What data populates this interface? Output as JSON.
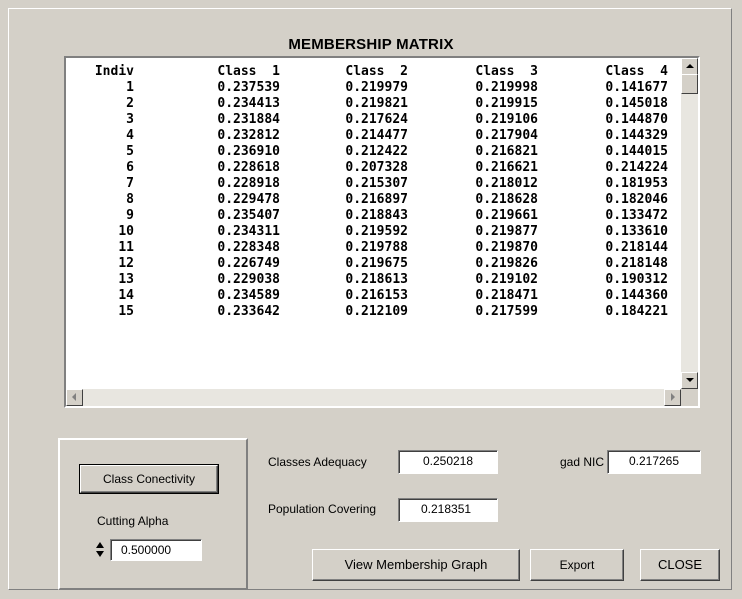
{
  "window": {
    "title": "MEMBERSHIP MATRIX"
  },
  "matrix": {
    "headers": [
      "Indiv",
      "Class  1",
      "Class  2",
      "Class  3",
      "Class  4"
    ],
    "rows": [
      [
        "1",
        "0.237539",
        "0.219979",
        "0.219998",
        "0.141677"
      ],
      [
        "2",
        "0.234413",
        "0.219821",
        "0.219915",
        "0.145018"
      ],
      [
        "3",
        "0.231884",
        "0.217624",
        "0.219106",
        "0.144870"
      ],
      [
        "4",
        "0.232812",
        "0.214477",
        "0.217904",
        "0.144329"
      ],
      [
        "5",
        "0.236910",
        "0.212422",
        "0.216821",
        "0.144015"
      ],
      [
        "6",
        "0.228618",
        "0.207328",
        "0.216621",
        "0.214224"
      ],
      [
        "7",
        "0.228918",
        "0.215307",
        "0.218012",
        "0.181953"
      ],
      [
        "8",
        "0.229478",
        "0.216897",
        "0.218628",
        "0.182046"
      ],
      [
        "9",
        "0.235407",
        "0.218843",
        "0.219661",
        "0.133472"
      ],
      [
        "10",
        "0.234311",
        "0.219592",
        "0.219877",
        "0.133610"
      ],
      [
        "11",
        "0.228348",
        "0.219788",
        "0.219870",
        "0.218144"
      ],
      [
        "12",
        "0.226749",
        "0.219675",
        "0.219826",
        "0.218148"
      ],
      [
        "13",
        "0.229038",
        "0.218613",
        "0.219102",
        "0.190312"
      ],
      [
        "14",
        "0.234589",
        "0.216153",
        "0.218471",
        "0.144360"
      ],
      [
        "15",
        "0.233642",
        "0.212109",
        "0.217599",
        "0.184221"
      ]
    ]
  },
  "controls": {
    "class_conectivity_label": "Class Conectivity",
    "cutting_alpha_label": "Cutting Alpha",
    "cutting_alpha_value": "0.500000",
    "classes_adequacy_label": "Classes Adequacy",
    "classes_adequacy_value": "0.250218",
    "gad_nic_label": "gad NIC",
    "gad_nic_value": "0.217265",
    "population_covering_label": "Population Covering",
    "population_covering_value": "0.218351",
    "view_graph_label": "View Membership Graph",
    "export_label": "Export",
    "close_label": "CLOSE"
  },
  "icons": {
    "scroll_up": "triangle-up-icon",
    "scroll_down": "triangle-down-icon",
    "scroll_left": "triangle-left-icon",
    "scroll_right": "triangle-right-icon",
    "spinner": "spinner-arrows-icon"
  }
}
